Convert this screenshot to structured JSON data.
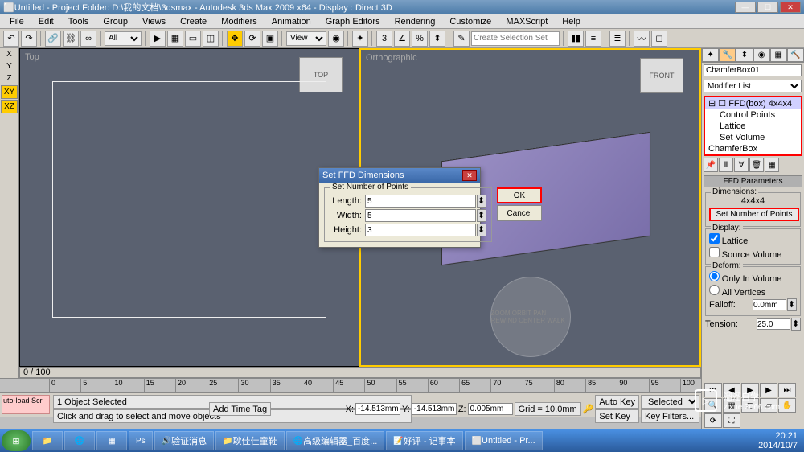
{
  "title_bar": {
    "text": "Untitled   - Project Folder: D:\\我的文档\\3dsmax   - Autodesk 3ds Max  2009 x64    - Display : Direct 3D"
  },
  "menu": [
    "File",
    "Edit",
    "Tools",
    "Group",
    "Views",
    "Create",
    "Modifiers",
    "Animation",
    "Graph Editors",
    "Rendering",
    "Customize",
    "MAXScript",
    "Help"
  ],
  "toolbar": {
    "view_dropdown": "View",
    "selection_set": "Create Selection Set"
  },
  "left_axis": {
    "x": "X",
    "y": "Y",
    "z": "Z",
    "xy": "XY",
    "xz": "XZ"
  },
  "viewports": {
    "left_label": "Top",
    "right_label": "Orthographic",
    "cube1": "TOP",
    "cube2": "FRONT",
    "nav_wheel": "ZOOM ORBIT PAN REWIND CENTER WALK"
  },
  "scroll": {
    "pos": "0 / 100"
  },
  "command_panel": {
    "object_name": "ChamferBox01",
    "modifier_list": "Modifier List",
    "stack": {
      "ffd": "FFD(box) 4x4x4",
      "cp": "Control Points",
      "lattice": "Lattice",
      "setvol": "Set Volume",
      "base": "ChamferBox"
    },
    "rollout_title": "FFD Parameters",
    "dimensions_grp": "Dimensions:",
    "dimensions_val": "4x4x4",
    "set_points_btn": "Set Number of Points",
    "display_grp": "Display:",
    "chk_lattice": "Lattice",
    "chk_source": "Source Volume",
    "deform_grp": "Deform:",
    "rad_only": "Only In Volume",
    "rad_all": "All Vertices",
    "falloff_lbl": "Falloff:",
    "falloff_val": "0.0mm",
    "tension_lbl": "Tension:",
    "tension_val": "25.0"
  },
  "dialog": {
    "title": "Set FFD Dimensions",
    "grp": "Set Number of Points",
    "length_lbl": "Length:",
    "length_val": "5",
    "width_lbl": "Width:",
    "width_val": "5",
    "height_lbl": "Height:",
    "height_val": "3",
    "ok": "OK",
    "cancel": "Cancel"
  },
  "timeline": {
    "ticks": [
      "0",
      "5",
      "10",
      "15",
      "20",
      "25",
      "30",
      "35",
      "40",
      "45",
      "50",
      "55",
      "60",
      "65",
      "70",
      "75",
      "80",
      "85",
      "90",
      "95",
      "100"
    ],
    "script_msg": "uto-load Scri"
  },
  "status": {
    "selected": "1 Object Selected",
    "prompt": "Click and drag to select and move objects",
    "x_lbl": "X:",
    "x_val": "-14.513mm",
    "y_lbl": "Y:",
    "y_val": "-14.513mm",
    "z_lbl": "Z:",
    "z_val": "0.005mm",
    "grid": "Grid = 10.0mm",
    "autokey": "Auto Key",
    "setkey": "Set Key",
    "selected2": "Selected",
    "keyfilters": "Key Filters...",
    "addtime": "Add Time Tag"
  },
  "taskbar": {
    "items": [
      "Ps",
      "验证消息",
      "耿佳佳童鞋",
      "高级编辑器_百度...",
      "好评 - 记事本",
      "Untitled   - Pr..."
    ],
    "time": "20:21",
    "date": "2014/10/7"
  },
  "watermark": {
    "brand": "溜溜自学",
    "url": "zixue.3d66.com"
  }
}
